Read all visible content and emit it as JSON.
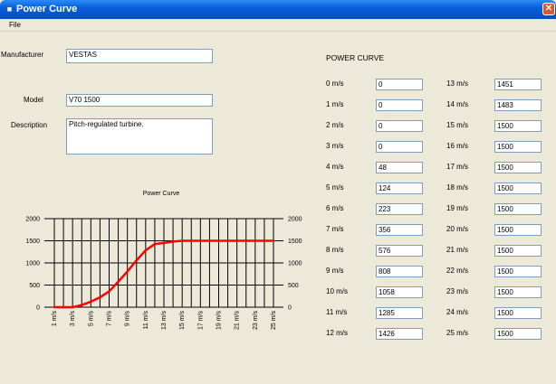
{
  "window": {
    "title": "Power Curve",
    "app_icon": "app-icon"
  },
  "menu": {
    "file": "File"
  },
  "form": {
    "manufacturer_label": "Manufacturer",
    "manufacturer_value": "VESTAS",
    "model_label": "Model",
    "model_value": "V70 1500",
    "description_label": "Description",
    "description_value": "Pitch-regulated turbine."
  },
  "power_curve": {
    "title": "POWER CURVE",
    "rows_left": [
      {
        "label": "0 m/s",
        "value": "0"
      },
      {
        "label": "1 m/s",
        "value": "0"
      },
      {
        "label": "2 m/s",
        "value": "0"
      },
      {
        "label": "3 m/s",
        "value": "0"
      },
      {
        "label": "4 m/s",
        "value": "48"
      },
      {
        "label": "5 m/s",
        "value": "124"
      },
      {
        "label": "6 m/s",
        "value": "223"
      },
      {
        "label": "7 m/s",
        "value": "356"
      },
      {
        "label": "8 m/s",
        "value": "576"
      },
      {
        "label": "9 m/s",
        "value": "808"
      },
      {
        "label": "10 m/s",
        "value": "1058"
      },
      {
        "label": "11 m/s",
        "value": "1285"
      },
      {
        "label": "12 m/s",
        "value": "1426"
      }
    ],
    "rows_right": [
      {
        "label": "13 m/s",
        "value": "1451"
      },
      {
        "label": "14 m/s",
        "value": "1483"
      },
      {
        "label": "15 m/s",
        "value": "1500"
      },
      {
        "label": "16 m/s",
        "value": "1500"
      },
      {
        "label": "17 m/s",
        "value": "1500"
      },
      {
        "label": "18 m/s",
        "value": "1500"
      },
      {
        "label": "19 m/s",
        "value": "1500"
      },
      {
        "label": "20 m/s",
        "value": "1500"
      },
      {
        "label": "21 m/s",
        "value": "1500"
      },
      {
        "label": "22 m/s",
        "value": "1500"
      },
      {
        "label": "23 m/s",
        "value": "1500"
      },
      {
        "label": "24 m/s",
        "value": "1500"
      },
      {
        "label": "25 m/s",
        "value": "1500"
      }
    ]
  },
  "chart_data": {
    "type": "line",
    "title": "Power Curve",
    "x": [
      "1 m/s",
      "2 m/s",
      "3 m/s",
      "4 m/s",
      "5 m/s",
      "6 m/s",
      "7 m/s",
      "8 m/s",
      "9 m/s",
      "10 m/s",
      "11 m/s",
      "12 m/s",
      "13 m/s",
      "14 m/s",
      "15 m/s",
      "16 m/s",
      "17 m/s",
      "18 m/s",
      "19 m/s",
      "20 m/s",
      "21 m/s",
      "22 m/s",
      "23 m/s",
      "24 m/s",
      "25 m/s"
    ],
    "x_tick_labels": [
      "1 m/s",
      "3 m/s",
      "5 m/s",
      "7 m/s",
      "9 m/s",
      "11 m/s",
      "13 m/s",
      "15 m/s",
      "17 m/s",
      "19 m/s",
      "21 m/s",
      "23 m/s",
      "25 m/s"
    ],
    "values": [
      0,
      0,
      0,
      48,
      124,
      223,
      356,
      576,
      808,
      1058,
      1285,
      1426,
      1451,
      1483,
      1500,
      1500,
      1500,
      1500,
      1500,
      1500,
      1500,
      1500,
      1500,
      1500,
      1500
    ],
    "y_ticks": [
      0,
      500,
      1000,
      1500,
      2000
    ],
    "ylim": [
      0,
      2000
    ],
    "line_color": "#ff0000",
    "grid": true,
    "legend": "none"
  }
}
